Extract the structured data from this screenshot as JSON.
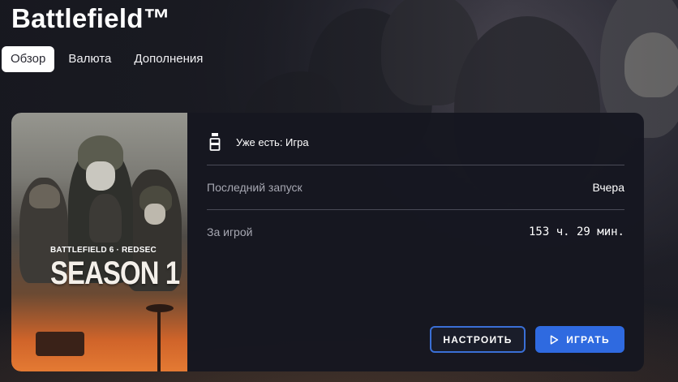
{
  "game": {
    "title": "Battlefield™"
  },
  "tabs": [
    {
      "label": "Обзор",
      "active": true
    },
    {
      "label": "Валюта",
      "active": false
    },
    {
      "label": "Дополнения",
      "active": false
    }
  ],
  "cover": {
    "brand_line": "BATTLEFIELD 6 · REDSEC",
    "season_text": "SEASON 1"
  },
  "ownership": {
    "icon": "bottle-icon",
    "text": "Уже есть: Игра"
  },
  "stats": {
    "last_launch_label": "Последний запуск",
    "last_launch_value": "Вчера",
    "playtime_label": "За игрой",
    "playtime_value": "153 ч. 29 мин."
  },
  "actions": {
    "configure_label": "НАСТРОИТЬ",
    "play_label": "ИГРАТЬ",
    "play_icon": "play-icon"
  },
  "colors": {
    "accent": "#2f6ae0",
    "card_bg": "#161720",
    "active_tab_bg": "#ffffff"
  }
}
